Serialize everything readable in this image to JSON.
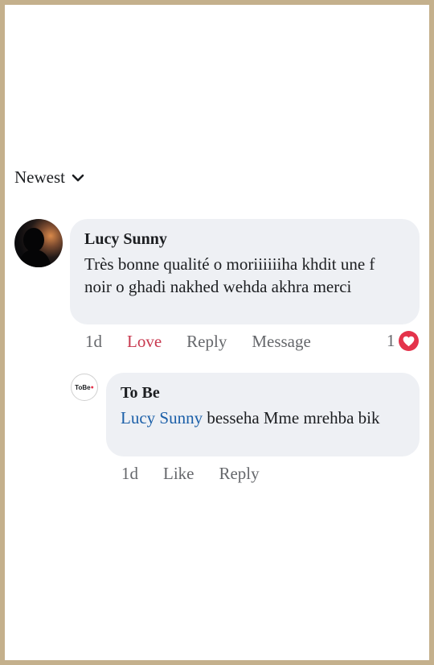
{
  "sort": {
    "label": "Newest"
  },
  "comments": [
    {
      "author": "Lucy Sunny",
      "text": "Très bonne qualité o moriiiiiiha khdit une f noir o ghadi nakhed wehda akhra merci",
      "time": "1d",
      "reaction": "Love",
      "reply": "Reply",
      "message": "Message",
      "reaction_count": "1",
      "reaction_icon": "heart-icon",
      "reaction_color": "#e4334b"
    },
    {
      "author": "To Be",
      "avatar_text": "ToBe",
      "mention": "Lucy Sunny",
      "text": " besseha Mme mrehba bik",
      "time": "1d",
      "like": "Like",
      "reply": "Reply"
    }
  ],
  "colors": {
    "border": "#c4b08c",
    "bubble": "#eef0f4",
    "love": "#c8394f",
    "mention": "#1b5fa8"
  }
}
